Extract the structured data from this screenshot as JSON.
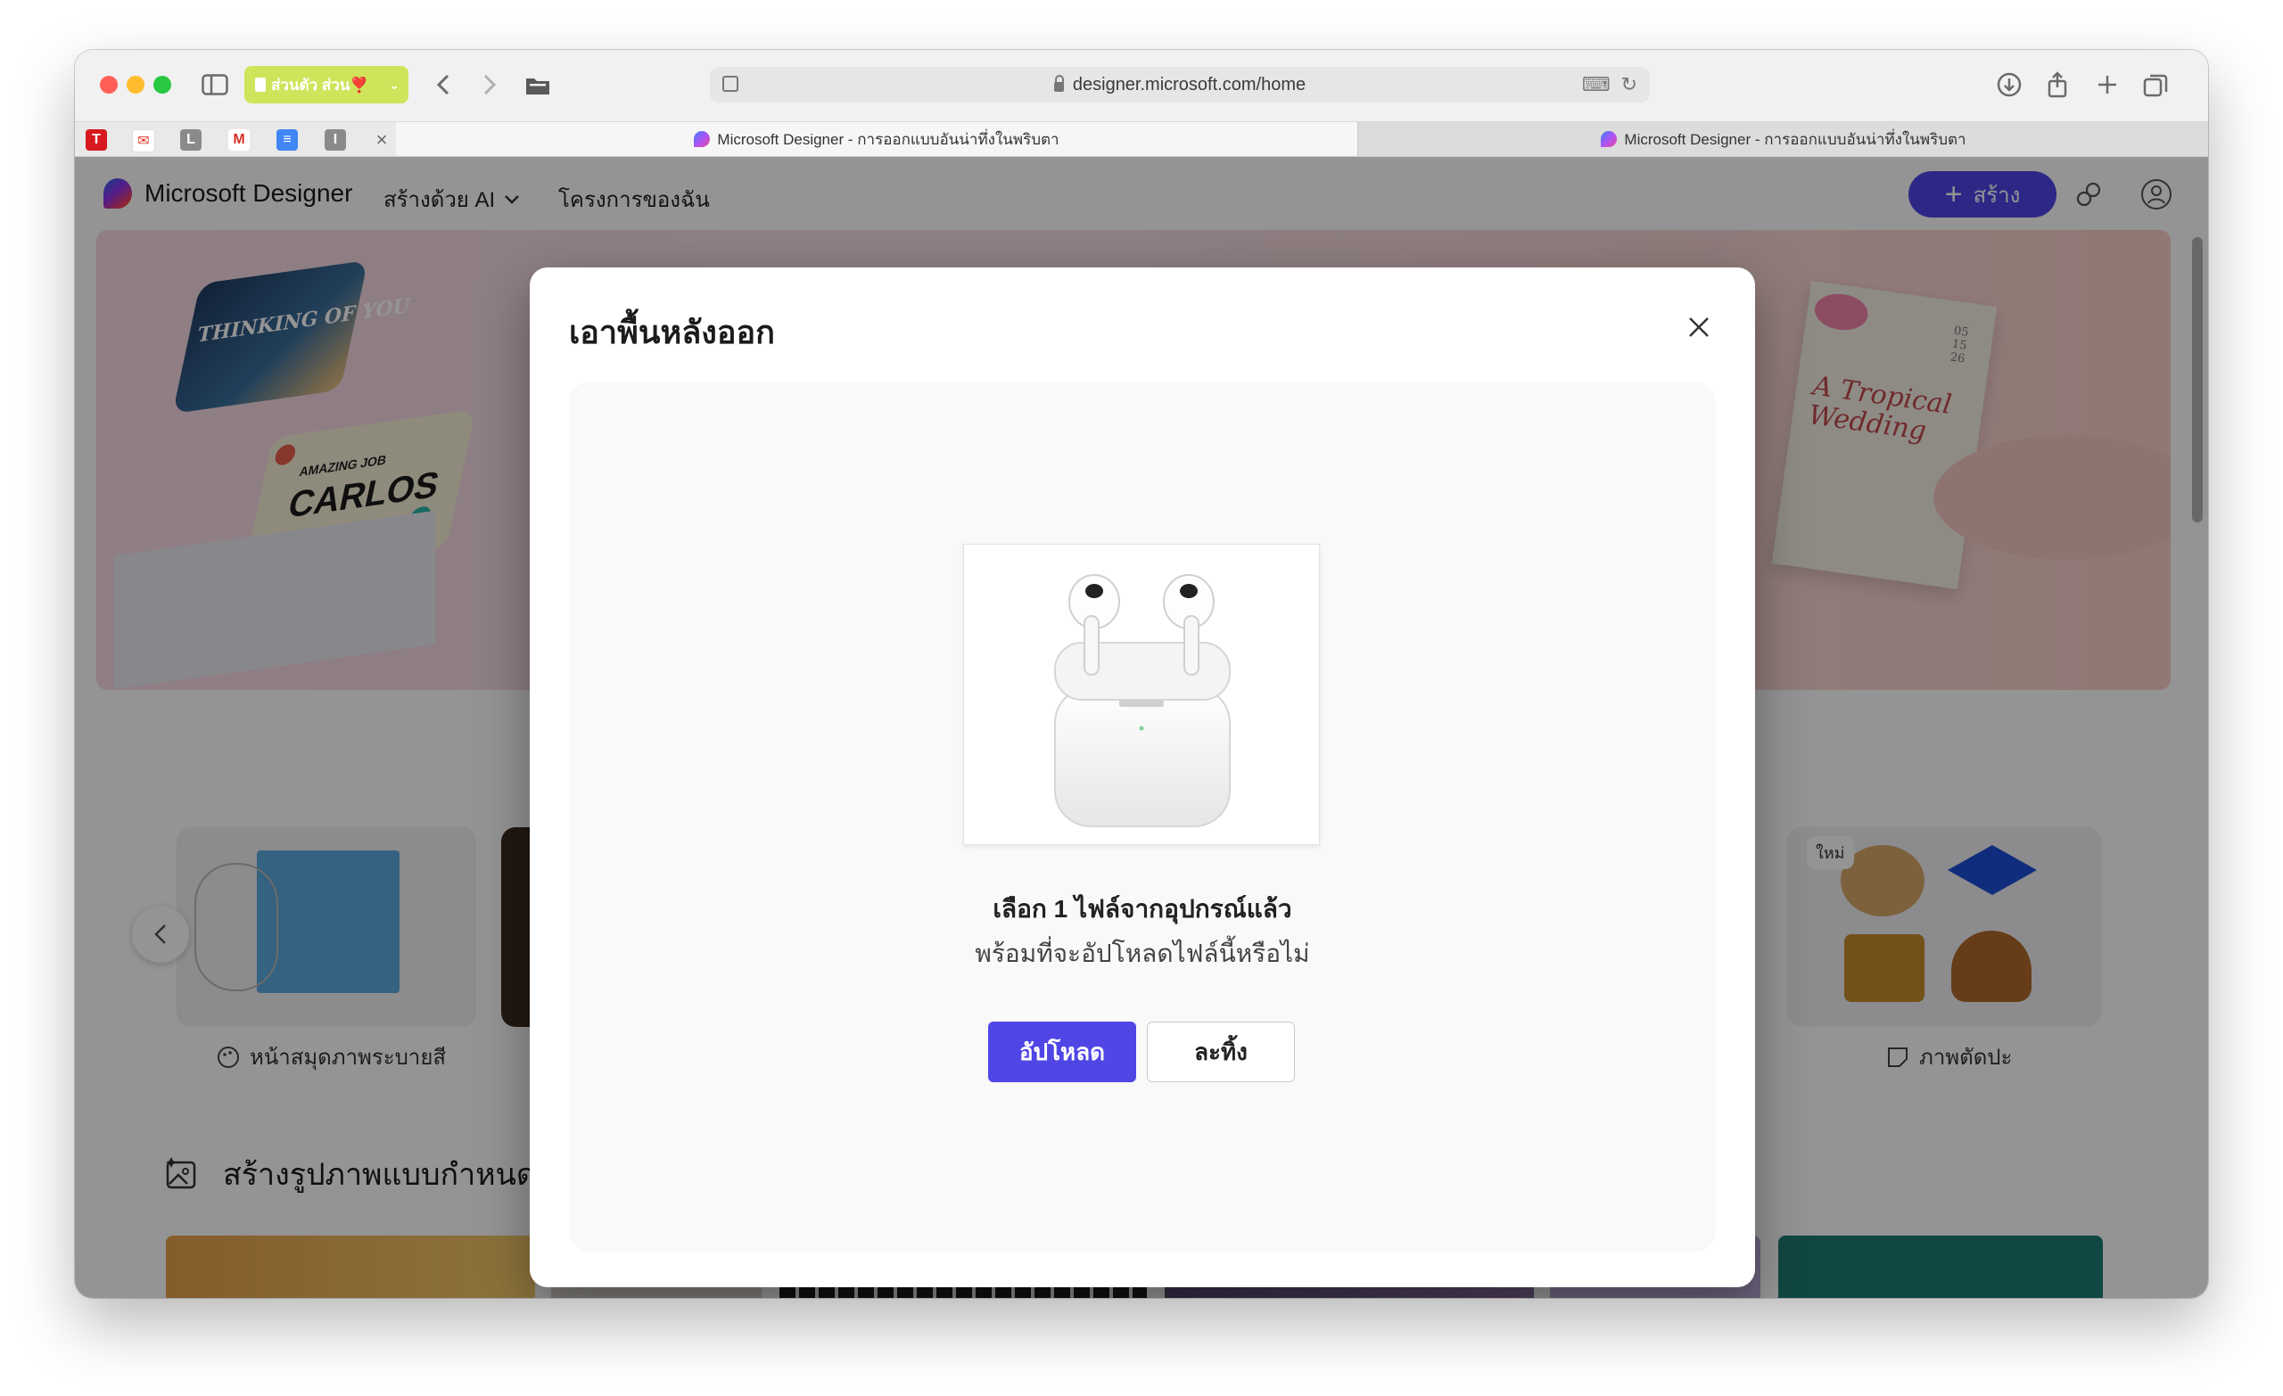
{
  "browser": {
    "profile_label": "ส่วนตัว ส่วน❣️",
    "url": "designer.microsoft.com/home",
    "tabs": [
      {
        "label": "Microsoft Designer - การออกแบบอันน่าทึ่งในพริบตา",
        "active": true
      },
      {
        "label": "Microsoft Designer - การออกแบบอันน่าทึ่งในพริบตา",
        "active": false
      }
    ],
    "pinned_favicons": [
      "T",
      "✉",
      "L",
      "M",
      "≡",
      "I"
    ],
    "close_glyph": "×"
  },
  "app": {
    "brand": "Microsoft Designer",
    "nav": [
      {
        "label": "สร้างด้วย AI",
        "has_dropdown": true
      },
      {
        "label": "โครงการของฉัน",
        "has_dropdown": false
      }
    ],
    "create_button": "สร้าง",
    "accent_color": "#4f46e5"
  },
  "hero": {
    "card_texts": [
      "THINKING OF YOU",
      "AMAZING JOB",
      "CARLOS",
      "A Tropical Wedding",
      "05 15 26"
    ]
  },
  "carousel": {
    "left_caption": "หน้าสมุดภาพระบายสี",
    "right_caption": "ภาพตัดปะ",
    "new_badge": "ใหม่"
  },
  "section": {
    "title": "สร้างรูปภาพแบบกำหนด"
  },
  "modal": {
    "title": "เอาพื้นหลังออก",
    "selected_text": "เลือก 1 ไฟล์จากอุปกรณ์แล้ว",
    "question_text": "พร้อมที่จะอัปโหลดไฟล์นี้หรือไม่",
    "upload_button": "อัปโหลด",
    "discard_button": "ละทิ้ง"
  }
}
